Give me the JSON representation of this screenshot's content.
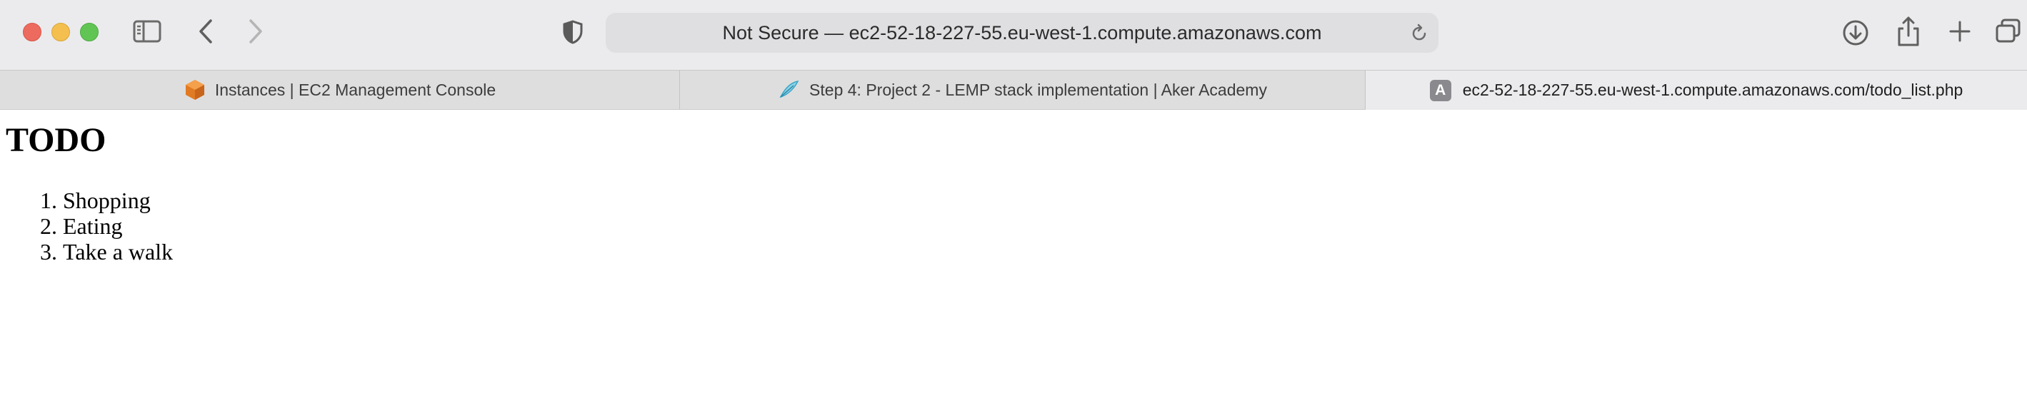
{
  "browser": {
    "address_text": "Not Secure — ec2-52-18-227-55.eu-west-1.compute.amazonaws.com",
    "icons": {
      "sidebar": "sidebar-icon",
      "back": "chevron-left-icon",
      "forward": "chevron-right-icon",
      "privacy": "shield-icon",
      "reload": "reload-icon",
      "downloads": "download-icon",
      "share": "share-icon",
      "new_tab": "plus-icon",
      "tab_overview": "tab-overview-icon"
    },
    "traffic_colors": {
      "close": "#ed6a5e",
      "minimize": "#f4bf4f",
      "zoom": "#61c554"
    }
  },
  "tabs": [
    {
      "title": "Instances | EC2 Management Console",
      "icon": "aws-cube-icon",
      "active": false
    },
    {
      "title": "Step 4: Project 2 - LEMP stack implementation | Aker Academy",
      "icon": "aker-feather-icon",
      "active": false
    },
    {
      "title": "ec2-52-18-227-55.eu-west-1.compute.amazonaws.com/todo_list.php",
      "icon": "letter-a-favicon",
      "favicon_letter": "A",
      "active": true
    }
  ],
  "page": {
    "heading": "TODO",
    "items": [
      "Shopping",
      "Eating",
      "Take a walk"
    ]
  }
}
